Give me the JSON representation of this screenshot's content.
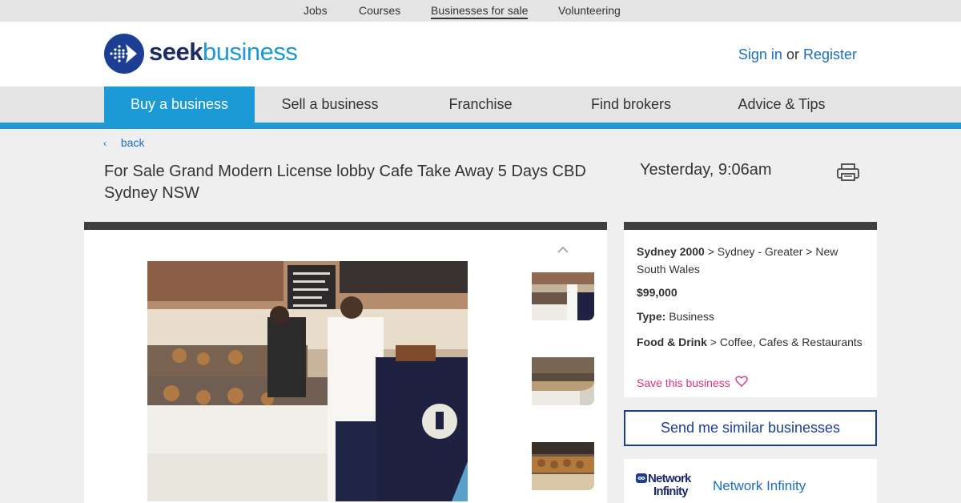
{
  "topbar": {
    "items": [
      "Jobs",
      "Courses",
      "Businesses for sale",
      "Volunteering"
    ],
    "active_index": 2
  },
  "header": {
    "logo_seek": "seek",
    "logo_business": "business",
    "sign_in": "Sign in",
    "or": "or",
    "register": "Register"
  },
  "nav": {
    "items": [
      "Buy a business",
      "Sell a business",
      "Franchise",
      "Find brokers",
      "Advice & Tips"
    ],
    "active_index": 0
  },
  "back_label": "back",
  "listing": {
    "title": "For Sale Grand Modern License lobby Cafe Take Away 5 Days CBD Sydney NSW",
    "date": "Yesterday, 9:06am"
  },
  "details": {
    "location_bold": "Sydney 2000",
    "location_rest": " > Sydney - Greater > New South Wales",
    "price": "$99,000",
    "type_label": "Type:",
    "type_value": " Business",
    "category_bold": "Food & Drink",
    "category_rest": " > Coffee, Cafes & Restaurants",
    "save_label": "Save this business"
  },
  "similar_button": "Send me similar businesses",
  "broker": {
    "logo_line1": "Network",
    "logo_line2": "Infinity",
    "name": "Network Infinity"
  },
  "colors": {
    "brand_navy": "#1c3f94",
    "brand_blue": "#1b9ad6",
    "link_blue": "#1b6ec2",
    "save_pink": "#d63384",
    "card_top_border": "#3f3f3f"
  }
}
